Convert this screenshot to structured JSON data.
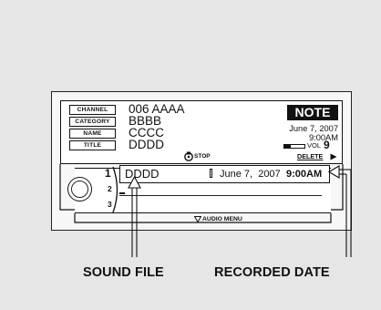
{
  "display": {
    "labels": {
      "channel": "CHANNEL",
      "category": "CATEGORY",
      "name": "NAME",
      "title": "TITLE"
    },
    "values": {
      "channel": "006 AAAA",
      "category": "BBBB",
      "name": "CCCC",
      "title": "DDDD"
    },
    "note_button": "NOTE",
    "date": "June 7, 2007",
    "time": "9:00AM",
    "volume_label": "VOL",
    "volume_value": "9",
    "stop_label": "STOP",
    "delete_label": "DELETE",
    "list": {
      "row_numbers": [
        "1",
        "2",
        "3"
      ],
      "file_name": "DDDD",
      "date": "June 7,  2007",
      "time": "9:00AM"
    },
    "audio_menu_label": "AUDIO MENU"
  },
  "callouts": {
    "sound_file": "SOUND FILE",
    "recorded_date": "RECORDED DATE"
  },
  "colors": {
    "background": "#e6e6e6",
    "ink": "#111111",
    "panel": "#ffffff"
  }
}
